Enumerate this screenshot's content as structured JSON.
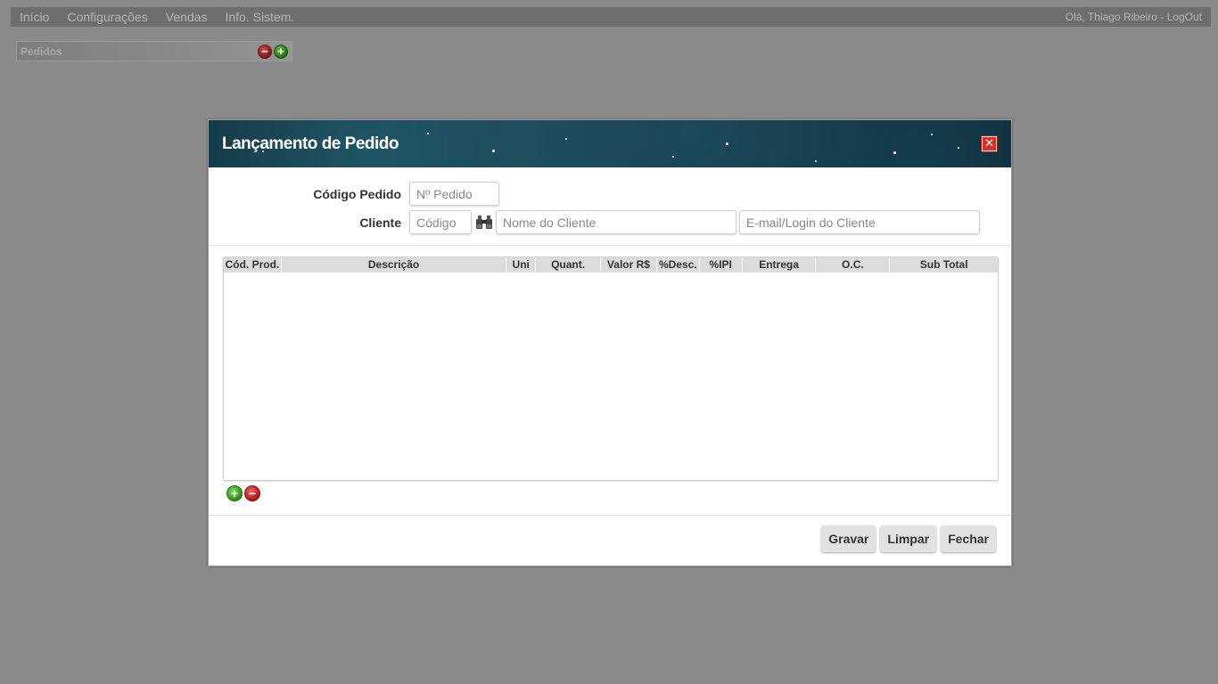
{
  "menu": {
    "items": [
      {
        "label": "Início"
      },
      {
        "label": "Configurações"
      },
      {
        "label": "Vendas"
      },
      {
        "label": "Info. Sistem."
      }
    ],
    "greeting": "Olá, Thiago Ribeiro - LogOut"
  },
  "panel": {
    "title": "Pedidos",
    "remove_symbol": "−",
    "add_symbol": "+"
  },
  "dialog": {
    "title": "Lançamento de Pedido",
    "close_symbol": "✕",
    "form": {
      "order_code_label": "Código Pedido",
      "order_code_placeholder": "Nº Pedido",
      "order_code_value": "",
      "client_label": "Cliente",
      "client_code_placeholder": "Código",
      "client_code_value": "",
      "client_name_placeholder": "Nome do Cliente",
      "client_name_value": "",
      "client_email_placeholder": "E-mail/Login do Cliente",
      "client_email_value": "",
      "lookup_icon": "binoculars-icon"
    },
    "grid": {
      "columns": [
        "Cód. Prod.",
        "Descrição",
        "Uni",
        "Quant.",
        "Valor R$",
        "%Desc.",
        "%IPI",
        "Entrega",
        "O.C.",
        "Sub Total"
      ],
      "rows": []
    },
    "grid_actions": {
      "add_symbol": "+",
      "remove_symbol": "−"
    },
    "buttons": {
      "save": "Gravar",
      "clear": "Limpar",
      "close": "Fechar"
    }
  },
  "colors": {
    "overlay_background": "#8a8a8a",
    "menubar": "#6e6e6e",
    "close_button": "#d9302c",
    "add_green": "#2a8a11",
    "remove_red": "#a11111"
  }
}
